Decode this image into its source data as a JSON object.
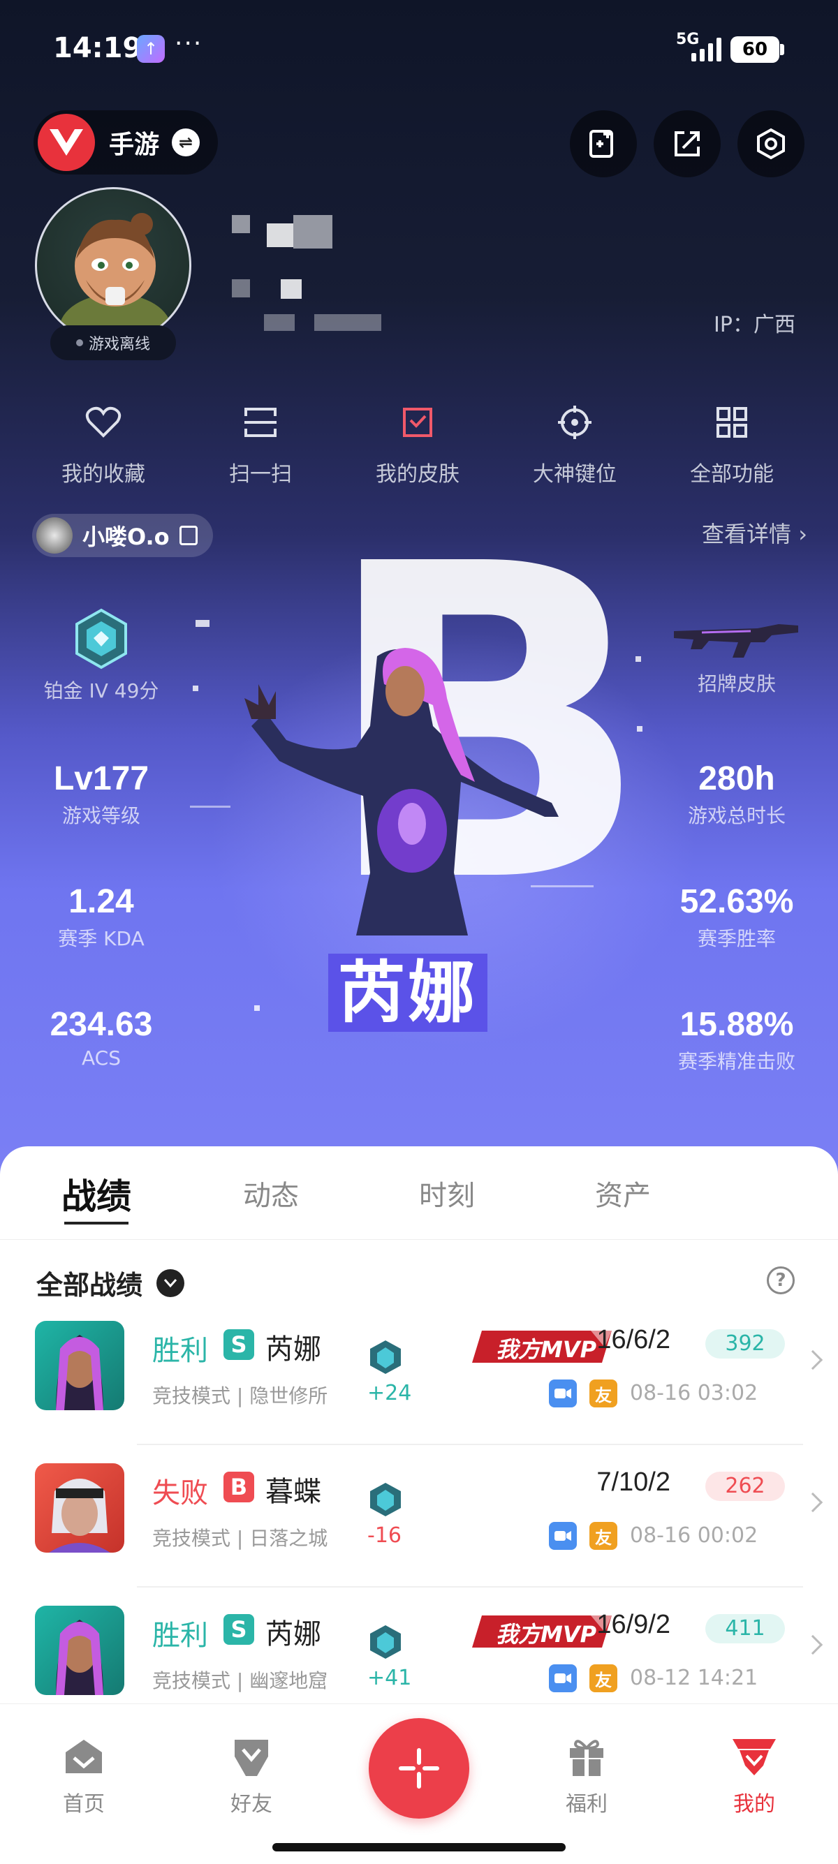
{
  "status_bar": {
    "time": "14:19",
    "network": "5G",
    "battery": "60"
  },
  "top_bar": {
    "mode_label": "手游"
  },
  "profile": {
    "status": "游戏离线",
    "ip": "IP：广西"
  },
  "quick_actions": [
    {
      "label": "我的收藏",
      "icon": "heart-icon"
    },
    {
      "label": "扫一扫",
      "icon": "scan-icon"
    },
    {
      "label": "我的皮肤",
      "icon": "skin-icon"
    },
    {
      "label": "大神键位",
      "icon": "crosshair-icon"
    },
    {
      "label": "全部功能",
      "icon": "grid-icon"
    }
  ],
  "game_card": {
    "account_name": "小喽O.o",
    "detail_link": "查看详情",
    "rating_letter": "B",
    "character": "芮娜",
    "rank_label": "铂金 IV 49分",
    "signature_skin_label": "招牌皮肤",
    "stats": {
      "level": {
        "value": "Lv177",
        "label": "游戏等级"
      },
      "hours": {
        "value": "280h",
        "label": "游戏总时长"
      },
      "kda": {
        "value": "1.24",
        "label": "赛季 KDA"
      },
      "winrate": {
        "value": "52.63%",
        "label": "赛季胜率"
      },
      "acs": {
        "value": "234.63",
        "label": "ACS"
      },
      "headshot": {
        "value": "15.88%",
        "label": "赛季精准击败"
      }
    }
  },
  "tabs": [
    "战绩",
    "动态",
    "时刻",
    "资产"
  ],
  "filter": {
    "label": "全部战绩"
  },
  "matches": [
    {
      "result": "胜利",
      "grade": "S",
      "hero": "芮娜",
      "mode_map": "竞技模式 | 隐世修所",
      "delta": "+24",
      "mvp": "我方MVP",
      "kda": "16/6/2",
      "score": "392",
      "friend_badge": "友",
      "time": "08-16 03:02"
    },
    {
      "result": "失败",
      "grade": "B",
      "hero": "暮蝶",
      "mode_map": "竞技模式 | 日落之城",
      "delta": "-16",
      "mvp": "",
      "kda": "7/10/2",
      "score": "262",
      "friend_badge": "友",
      "time": "08-16 00:02"
    },
    {
      "result": "胜利",
      "grade": "S",
      "hero": "芮娜",
      "mode_map": "竞技模式 | 幽邃地窟",
      "delta": "+41",
      "mvp": "我方MVP",
      "kda": "16/9/2",
      "score": "411",
      "friend_badge": "友",
      "time": "08-12 14:21"
    }
  ],
  "bottom_nav": [
    {
      "label": "首页",
      "icon": "home-icon"
    },
    {
      "label": "好友",
      "icon": "friends-icon"
    },
    {
      "label": "福利",
      "icon": "gift-icon"
    },
    {
      "label": "我的",
      "icon": "profile-icon"
    }
  ],
  "colors": {
    "win": "#2bb5a8",
    "loss": "#ef4c52",
    "accent": "#ec3f4a",
    "grade_s": "#2bb5a8",
    "grade_b": "#ef4c52"
  }
}
